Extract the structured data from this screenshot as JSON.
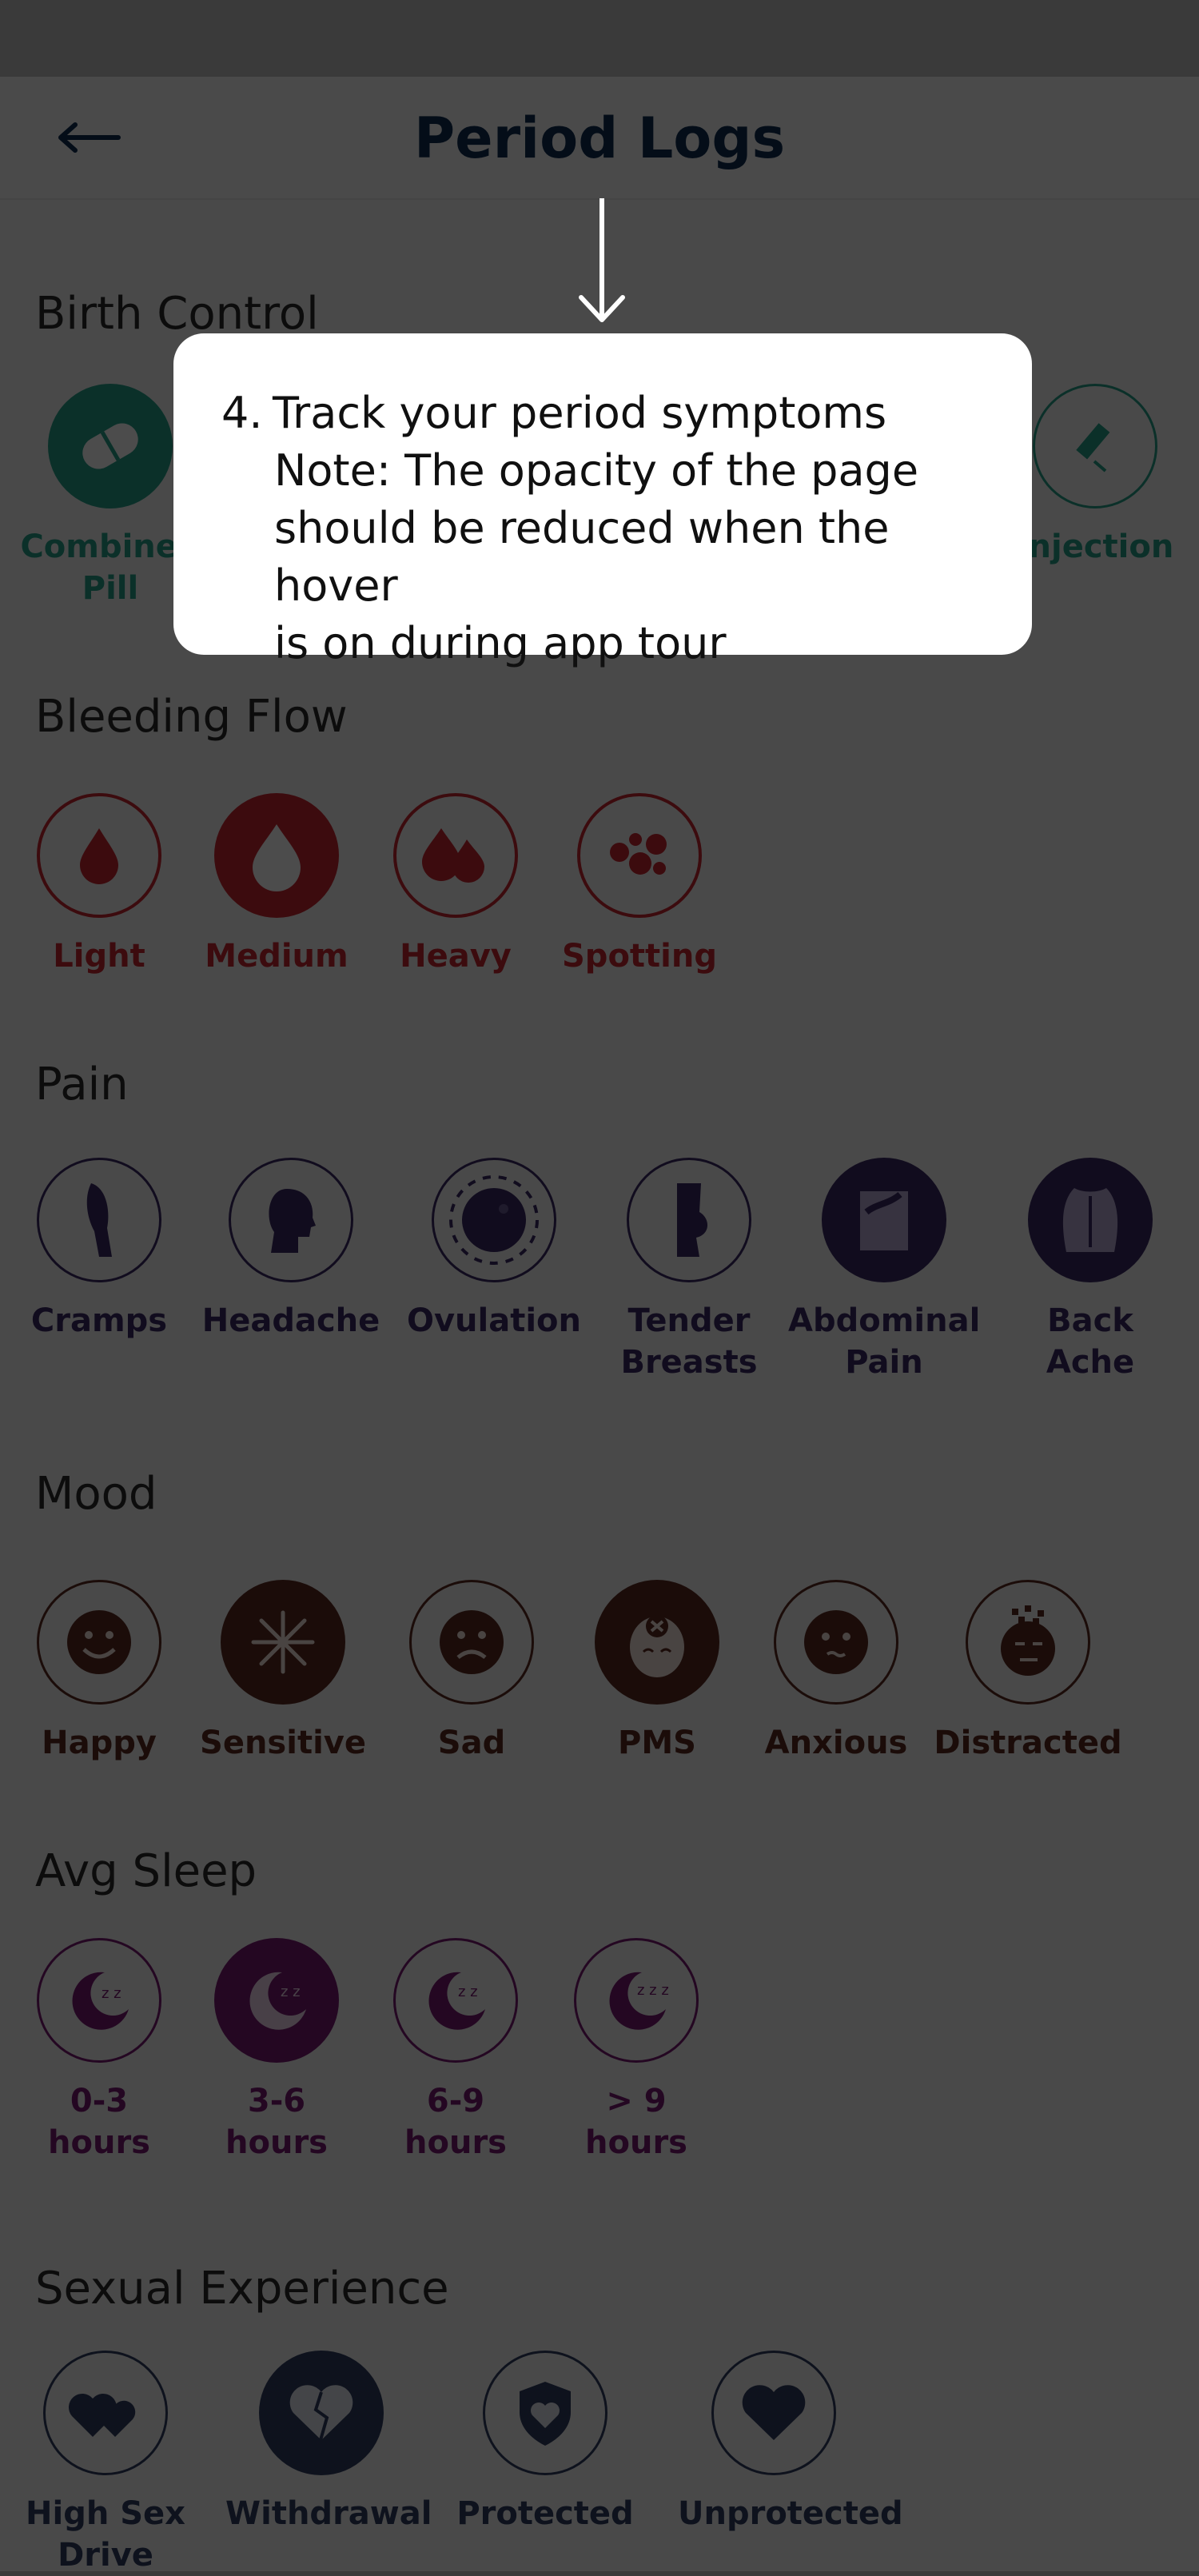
{
  "header": {
    "title": "Period Logs",
    "back_icon": "arrow-left-icon"
  },
  "tour": {
    "step": "4.",
    "heading": "Track your period symptoms",
    "note_line1": "Note: The opacity of the page",
    "note_line2": "should be reduced when the hover",
    "note_line3": "is on during app tour"
  },
  "sections": {
    "birth_control": {
      "title": "Birth Control",
      "items": [
        {
          "label_line1": "Combined",
          "label_line2": "Pill",
          "icon": "pill-icon"
        },
        {
          "label_line1": "Injection",
          "label_line2": "",
          "icon": "injection-icon"
        }
      ]
    },
    "bleeding_flow": {
      "title": "Bleeding Flow",
      "items": [
        {
          "label": "Light",
          "icon": "single-drop-icon"
        },
        {
          "label": "Medium",
          "icon": "medium-drop-icon"
        },
        {
          "label": "Heavy",
          "icon": "heavy-drops-icon"
        },
        {
          "label": "Spotting",
          "icon": "spotting-icon"
        }
      ]
    },
    "pain": {
      "title": "Pain",
      "items": [
        {
          "label_line1": "Cramps",
          "label_line2": "",
          "icon": "cramps-icon"
        },
        {
          "label_line1": "Headache",
          "label_line2": "",
          "icon": "headache-icon"
        },
        {
          "label_line1": "Ovulation",
          "label_line2": "",
          "icon": "ovulation-icon"
        },
        {
          "label_line1": "Tender",
          "label_line2": "Breasts",
          "icon": "tender-breasts-icon"
        },
        {
          "label_line1": "Abdominal",
          "label_line2": "Pain",
          "icon": "abdominal-pain-icon"
        },
        {
          "label_line1": "Back",
          "label_line2": "Ache",
          "icon": "back-ache-icon"
        }
      ]
    },
    "mood": {
      "title": "Mood",
      "items": [
        {
          "label": "Happy",
          "icon": "happy-face-icon"
        },
        {
          "label": "Sensitive",
          "icon": "snowflake-icon"
        },
        {
          "label": "Sad",
          "icon": "sad-face-icon"
        },
        {
          "label": "PMS",
          "icon": "pms-face-icon"
        },
        {
          "label": "Anxious",
          "icon": "anxious-face-icon"
        },
        {
          "label": "Distracted",
          "icon": "distracted-face-icon"
        }
      ]
    },
    "avg_sleep": {
      "title": "Avg Sleep",
      "items": [
        {
          "label_line1": "0-3",
          "label_line2": "hours",
          "icon": "moon-sleep-icon"
        },
        {
          "label_line1": "3-6",
          "label_line2": "hours",
          "icon": "moon-sleep-icon"
        },
        {
          "label_line1": "6-9",
          "label_line2": "hours",
          "icon": "moon-sleep-icon"
        },
        {
          "label_line1": "> 9",
          "label_line2": "hours",
          "icon": "moon-sleep-icon"
        }
      ]
    },
    "sexual_experience": {
      "title": "Sexual Experience",
      "items": [
        {
          "label_line1": "High Sex",
          "label_line2": "Drive",
          "icon": "double-heart-icon"
        },
        {
          "label_line1": "Withdrawal",
          "label_line2": "",
          "icon": "broken-heart-icon"
        },
        {
          "label_line1": "Protected",
          "label_line2": "",
          "icon": "shield-heart-icon"
        },
        {
          "label_line1": "Unprotected",
          "label_line2": "",
          "icon": "heart-icon"
        }
      ]
    }
  },
  "colors": {
    "title": "#0e2d52",
    "birth_control": "#27a08a",
    "bleeding": "#c8262f",
    "pain": "#3b2a66",
    "mood": "#5a2a20",
    "sleep": "#7a1a72",
    "sexual": "#2f3e63",
    "overlay": "rgba(0,0,0,0.70)"
  }
}
